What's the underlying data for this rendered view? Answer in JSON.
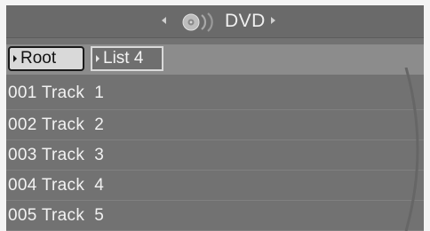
{
  "header": {
    "title": "DVD",
    "left_arrow_icon": "chevron-left-icon",
    "right_arrow_icon": "chevron-right-icon",
    "disc_icon": "disc-icon"
  },
  "breadcrumb": {
    "items": [
      {
        "label": "Root",
        "selected": true
      },
      {
        "label": "List 4",
        "selected": false
      }
    ]
  },
  "tracks": [
    {
      "label": "001 Track  1"
    },
    {
      "label": "002 Track  2"
    },
    {
      "label": "003 Track  3"
    },
    {
      "label": "004 Track  4"
    },
    {
      "label": "005 Track  5"
    }
  ],
  "colors": {
    "background": "#727272",
    "selected_crumb": "#d9d9d9",
    "text": "#f2f2f2"
  }
}
